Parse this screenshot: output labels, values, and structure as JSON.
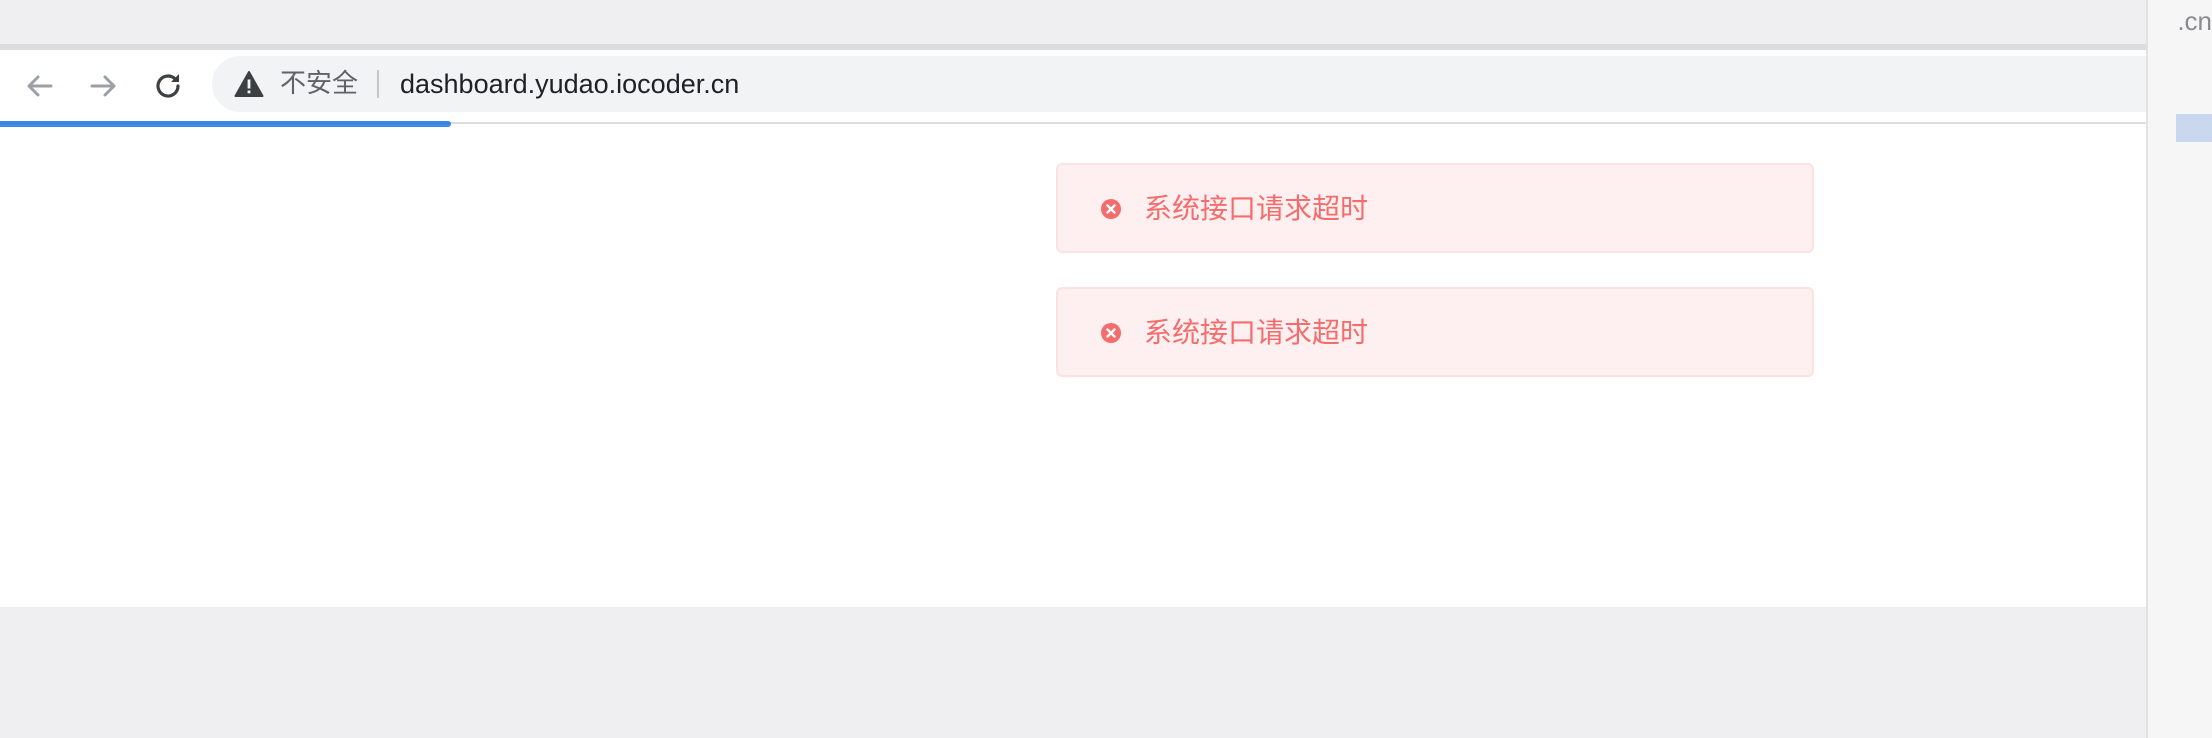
{
  "browser": {
    "security_label": "不安全",
    "url": "dashboard.yudao.iocoder.cn",
    "loading_progress_percent": 21
  },
  "messages": [
    {
      "type": "error",
      "icon": "error-circle-icon",
      "text": "系统接口请求超时"
    },
    {
      "type": "error",
      "icon": "error-circle-icon",
      "text": "系统接口请求超时"
    }
  ],
  "side_window": {
    "url_fragment": ".cn"
  },
  "colors": {
    "error_text": "#f56c6c",
    "error_background": "#fef0f0",
    "error_border": "#fde2e2",
    "progress": "#1a73e8"
  }
}
